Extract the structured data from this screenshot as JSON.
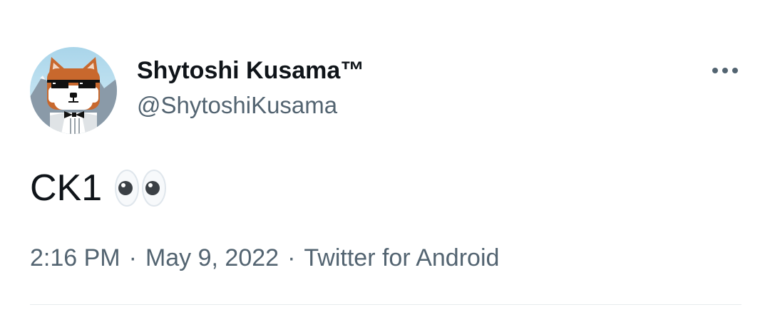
{
  "tweet": {
    "author": {
      "display_name": "Shytoshi Kusama™",
      "handle": "@ShytoshiKusama"
    },
    "text": "CK1",
    "emoji": "eyes",
    "timestamp": {
      "time": "2:16 PM",
      "separator": "·",
      "date": "May 9, 2022",
      "source": "Twitter for Android"
    }
  },
  "icons": {
    "more": "more-horizontal-icon",
    "avatar": "shiba-inu-avatar"
  },
  "colors": {
    "text_primary": "#0f1419",
    "text_secondary": "#536471",
    "divider": "#e6ebee",
    "background": "#ffffff"
  }
}
